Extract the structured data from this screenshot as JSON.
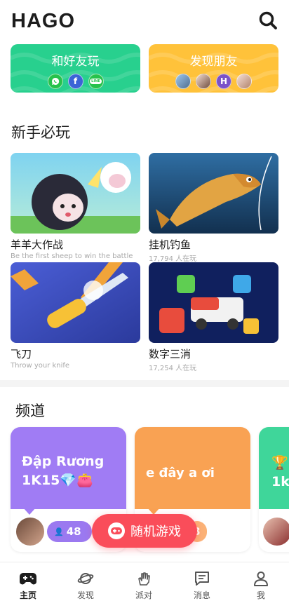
{
  "header": {
    "logo": "HAGO"
  },
  "social": {
    "friends": {
      "title": "和好友玩",
      "icons": [
        "whatsapp-icon",
        "facebook-icon",
        "line-icon"
      ],
      "line_text": "LINE",
      "fb_text": "f"
    },
    "find": {
      "title": "发现朋友",
      "avatar_letter": "H"
    }
  },
  "sections": {
    "newbie": "新手必玩",
    "channel": "频道"
  },
  "games": [
    {
      "name": "羊羊大作战",
      "sub": "Be the first sheep to win the battle"
    },
    {
      "name": "挂机钓鱼",
      "sub": "17,794 人在玩"
    },
    {
      "name": "飞刀",
      "sub": "Throw your knife"
    },
    {
      "name": "数字三消",
      "sub": "17,254 人在玩"
    }
  ],
  "channels": [
    {
      "title_line1": "Đập Rương",
      "title_line2": "1K15💎👛",
      "color": "#a07cf4",
      "online": "48"
    },
    {
      "title_line1": "e đây a ơi",
      "title_line2": "",
      "color": "#f9a253",
      "online": "8"
    },
    {
      "title_line1": "🏆",
      "title_line2": "1k",
      "color": "#3fd69a"
    }
  ],
  "random_button": {
    "label": "随机游戏"
  },
  "tabs": [
    {
      "label": "主页",
      "icon": "gamepad-icon"
    },
    {
      "label": "发现",
      "icon": "planet-icon"
    },
    {
      "label": "派对",
      "icon": "hand-icon"
    },
    {
      "label": "消息",
      "icon": "message-icon"
    },
    {
      "label": "我",
      "icon": "person-icon"
    }
  ],
  "colors": {
    "green": "#28d08e",
    "yellow": "#ffc23a",
    "red": "#fa4d5a",
    "purple": "#a07cf4",
    "orange": "#f9a253"
  }
}
